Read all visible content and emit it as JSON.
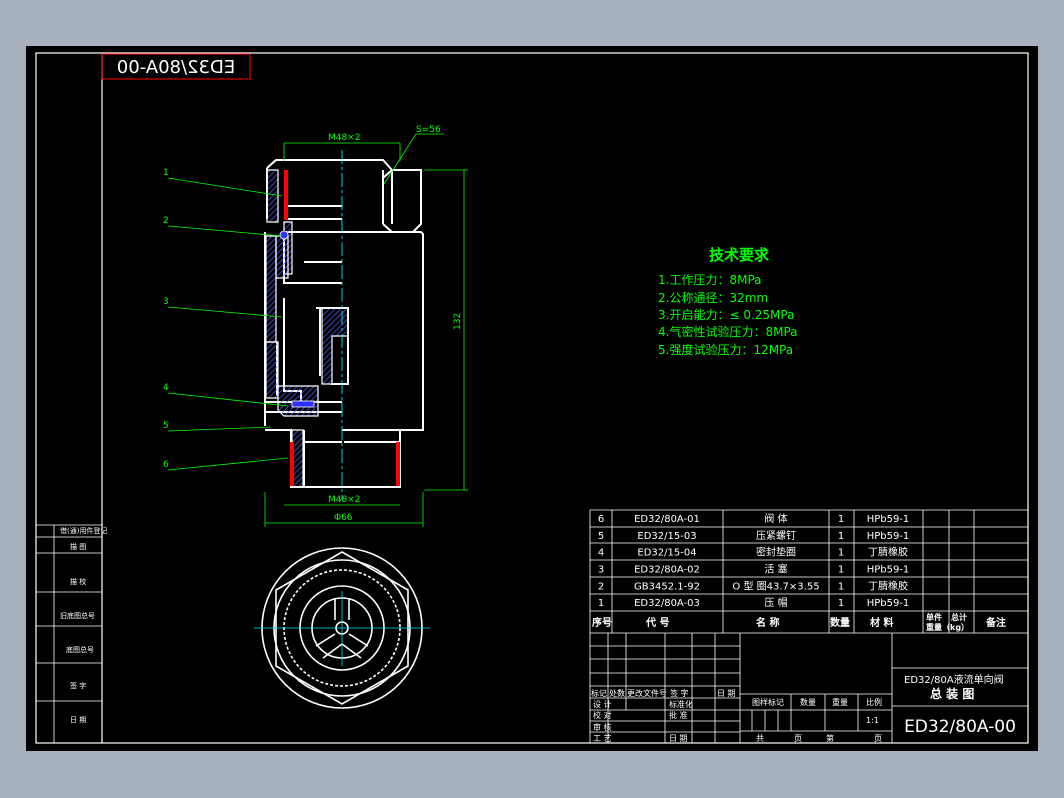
{
  "stamp_mirrored": "ED32/80A-00",
  "colors": {
    "bg": "#000000",
    "line": "#ffffff",
    "green": "#00ff00",
    "cyan": "#00e5ff",
    "red": "#ff0000",
    "blue": "#4040ff"
  },
  "tech": {
    "title": "技术要求",
    "items": [
      "1.工作压力：8MPa",
      "2.公称通径：32mm",
      "3.开启能力：≤ 0.25MPa",
      "4.气密性试验压力：8MPa",
      "5.强度试验压力：12MPa"
    ]
  },
  "dims": {
    "top_thread": "M48×2",
    "hex": "S=56",
    "height": "132",
    "bottom_thread": "M48×2",
    "diameter": "Φ66"
  },
  "callouts": [
    "1",
    "2",
    "3",
    "4",
    "5",
    "6"
  ],
  "left_strip": [
    "借(通)用件登记",
    "描 图",
    "描 校",
    "旧底图总号",
    "底图总号",
    "签 字",
    "日 期"
  ],
  "bom": {
    "rows": [
      {
        "no": "6",
        "code": "ED32/80A-01",
        "name": "阀 体",
        "qty": "1",
        "mat": "HPb59-1"
      },
      {
        "no": "5",
        "code": "ED32/15-03",
        "name": "压紧螺钉",
        "qty": "1",
        "mat": "HPb59-1"
      },
      {
        "no": "4",
        "code": "ED32/15-04",
        "name": "密封垫圈",
        "qty": "1",
        "mat": "丁腈橡胶"
      },
      {
        "no": "3",
        "code": "ED32/80A-02",
        "name": "活 塞",
        "qty": "1",
        "mat": "HPb59-1"
      },
      {
        "no": "2",
        "code": "GB3452.1-92",
        "name": "O 型 圈43.7×3.55",
        "qty": "1",
        "mat": "丁腈橡胶"
      },
      {
        "no": "1",
        "code": "ED32/80A-03",
        "name": "压 帽",
        "qty": "1",
        "mat": "HPb59-1"
      }
    ],
    "header": {
      "no": "序号",
      "code": "代 号",
      "name": "名 称",
      "qty": "数量",
      "mat": "材 料",
      "unit": "单件",
      "total": "总计",
      "weight": "重量（kg）",
      "remark": "备注"
    }
  },
  "title_block": {
    "part_name": "ED32/80A液流单向阀",
    "drawing_type": "总 装 图",
    "drawing_no": "ED32/80A-00",
    "rev_labels": [
      "标记",
      "处数",
      "更改文件号",
      "签 字",
      "日 期"
    ],
    "sign_rows": [
      "设 计",
      "校 对",
      "审 核",
      "工 艺"
    ],
    "mid_labels": [
      "标准化",
      "批 准",
      "日 期"
    ],
    "stage_labels": [
      "图样标记",
      "数量",
      "重量",
      "比例"
    ],
    "scale": "1:1",
    "sheet": [
      "共",
      "页",
      "第",
      "页"
    ]
  }
}
